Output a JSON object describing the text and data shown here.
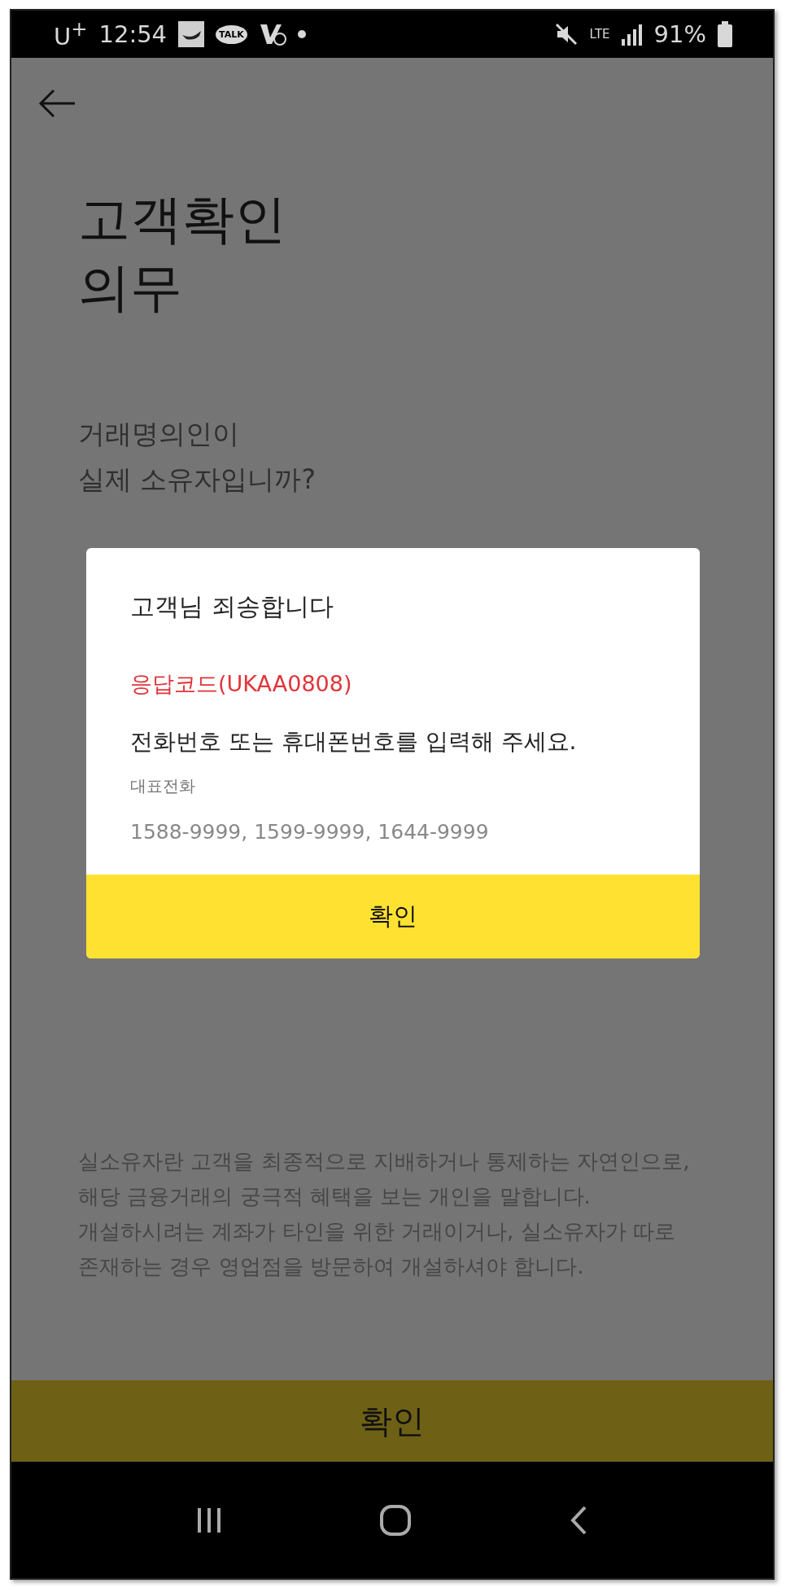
{
  "status_bar": {
    "carrier": "U$^{+}$",
    "time": "12:54",
    "talk_label": "TALK",
    "network": "LTE",
    "battery": "91%"
  },
  "title_lines": [
    "고객확인",
    "의무"
  ],
  "question_lines": [
    "거래명의인이",
    "실제 소유자입니까?"
  ],
  "notes": [
    "실소유자란 고객을 최종적으로 지배하거나 통제하는 자연인으로, 해당 금융거래의 궁극적 혜택을 보는 개인을 말합니다.",
    "개설하시려는 계좌가 타인을 위한 거래이거나, 실소유자가 따로 존재하는 경우 영업점을 방문하여 개설하셔야 합니다."
  ],
  "dialog": {
    "title": "고객님 죄송합니다",
    "code": "응답코드(UKAA0808)",
    "message": "전화번호 또는 휴대폰번호를 입력해 주세요.",
    "phone_label": "대표전화",
    "phone_numbers": "1588-9999, 1599-9999, 1644-9999",
    "button": "확인"
  },
  "confirm_button": "확인"
}
